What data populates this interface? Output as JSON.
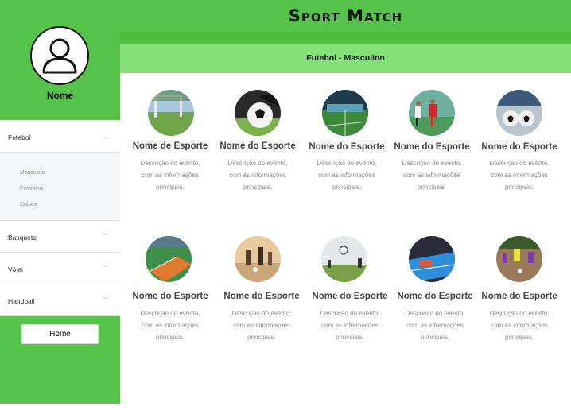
{
  "app": {
    "title": "Sport Match"
  },
  "subheader": {
    "text": "Futebol - Masculino"
  },
  "profile": {
    "name": "Nome"
  },
  "sidebar": {
    "items": [
      {
        "label": "Futebol",
        "expanded": true,
        "subitems": [
          "Masculino",
          "Feminino",
          "Unisex"
        ]
      },
      {
        "label": "Basquete",
        "expanded": false
      },
      {
        "label": "Vôlei",
        "expanded": false
      },
      {
        "label": "Handball",
        "expanded": false
      }
    ],
    "home_label": "Home"
  },
  "cards": [
    {
      "title": "Nome de Esporte",
      "desc": [
        "Descriçao do evento,",
        "com as informações",
        "principais."
      ],
      "icon": "soccer-field-goal-photo"
    },
    {
      "title": "Nome do Esporte",
      "desc": [
        "Descriçao do evento,",
        "com as informações",
        "principais."
      ],
      "icon": "soccer-ball-photo"
    },
    {
      "title": "Nome do Esporte",
      "desc": [
        "Descriçao do evento,",
        "com as informações",
        "principais."
      ],
      "icon": "indoor-field-photo"
    },
    {
      "title": "Nome do Esporte",
      "desc": [
        "Descriçao do evento,",
        "com as informações",
        "principais."
      ],
      "icon": "players-match-photo"
    },
    {
      "title": "Nome do Esporte",
      "desc": [
        "Descriçao do evento,",
        "com as informações",
        "principais."
      ],
      "icon": "soccer-balls-photo"
    },
    {
      "title": "Nome do Esporte",
      "desc": [
        "Descriçao do evento,",
        "com as informações",
        "principais."
      ],
      "icon": "futsal-court-photo"
    },
    {
      "title": "Nome do Esporte",
      "desc": [
        "Descriçao do evento,",
        "com as informações",
        "principais."
      ],
      "icon": "beach-soccer-photo"
    },
    {
      "title": "Nome do Esporte",
      "desc": [
        "Descriçao do evento,",
        "com as informações",
        "principais."
      ],
      "icon": "ball-in-air-photo"
    },
    {
      "title": "Nome do Esporte",
      "desc": [
        "Descriçao do evento,",
        "com as informações",
        "principais."
      ],
      "icon": "blue-court-photo"
    },
    {
      "title": "Nome do Esporte",
      "desc": [
        "Descriçao do evento,",
        "com as informações",
        "principais."
      ],
      "icon": "dirt-field-photo"
    }
  ],
  "colors": {
    "brand_green": "#56c44a",
    "light_green": "#86e07a",
    "dark_stripe": "#4cbd3f"
  }
}
